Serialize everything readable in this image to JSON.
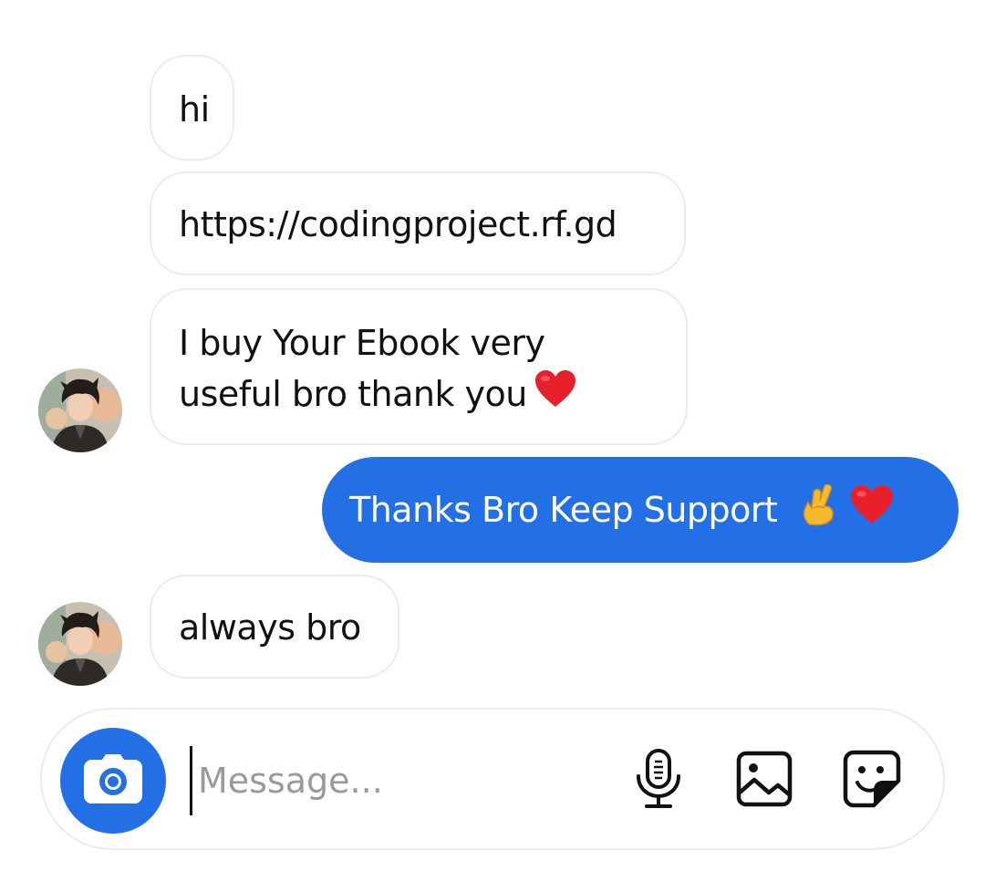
{
  "messages": {
    "received": [
      {
        "text": "hi"
      },
      {
        "text": "https://codingproject.rf.gd"
      },
      {
        "line1": "I buy Your Ebook very",
        "line2": "useful bro thank you"
      },
      {
        "text": "always bro"
      }
    ],
    "sent": [
      {
        "text": "Thanks Bro Keep Support"
      }
    ]
  },
  "composer": {
    "placeholder": "Message..."
  },
  "colors": {
    "accent": "#2370e6",
    "bubble_border": "#ececec",
    "heart": "#e8202c"
  },
  "icons": {
    "camera": "camera-icon",
    "microphone": "microphone-icon",
    "gallery": "image-icon",
    "sticker": "sticker-icon",
    "heart": "heart-emoji-icon",
    "crossed_fingers": "crossed-fingers-emoji-icon"
  }
}
